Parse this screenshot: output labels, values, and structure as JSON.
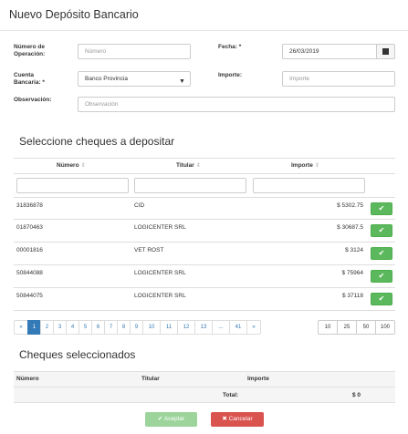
{
  "modal": {
    "title": "Nuevo Depósito Bancario"
  },
  "form": {
    "numero_label": "Número de\nOperación:",
    "numero_placeholder": "Número",
    "fecha_label": "Fecha: *",
    "fecha_value": "26/03/2019",
    "cuenta_label": "Cuenta\nBancaria: *",
    "cuenta_value": "Banco Provincia",
    "importe_label": "Importe:",
    "importe_placeholder": "Importe",
    "observacion_label": "Observación:",
    "observacion_placeholder": "Observación"
  },
  "cheques_table": {
    "title": "Seleccione cheques a depositar",
    "columns": [
      "Número",
      "Titular",
      "Importe"
    ],
    "sort_glyph": "⇕",
    "rows": [
      {
        "numero": "31836878",
        "titular": "CID",
        "importe": "$ 5302.75"
      },
      {
        "numero": "01870463",
        "titular": "LOGICENTER SRL",
        "importe": "$ 30687.5"
      },
      {
        "numero": "00001816",
        "titular": "VET ROST",
        "importe": "$ 3124"
      },
      {
        "numero": "50844088",
        "titular": "LOGICENTER SRL",
        "importe": "$ 75964"
      },
      {
        "numero": "50844075",
        "titular": "LOGICENTER SRL",
        "importe": "$ 37118"
      }
    ],
    "check_glyph": "✔"
  },
  "pagination": {
    "pages": [
      "«",
      "1",
      "2",
      "3",
      "4",
      "5",
      "6",
      "7",
      "8",
      "9",
      "10",
      "11",
      "12",
      "13",
      "...",
      "41",
      "»"
    ],
    "active": "1",
    "page_sizes": [
      "10",
      "25",
      "50",
      "100"
    ]
  },
  "selected": {
    "title": "Cheques seleccionados",
    "columns": [
      "Número",
      "Titular",
      "Importe"
    ],
    "total_label": "Total:",
    "total_value": "$ 0"
  },
  "footer": {
    "accept_label": "✔ Aceptar",
    "cancel_label": "✖ Cancelar"
  },
  "colors": {
    "primary": "#337ab7",
    "success": "#5cb85c",
    "danger": "#d9534f"
  }
}
